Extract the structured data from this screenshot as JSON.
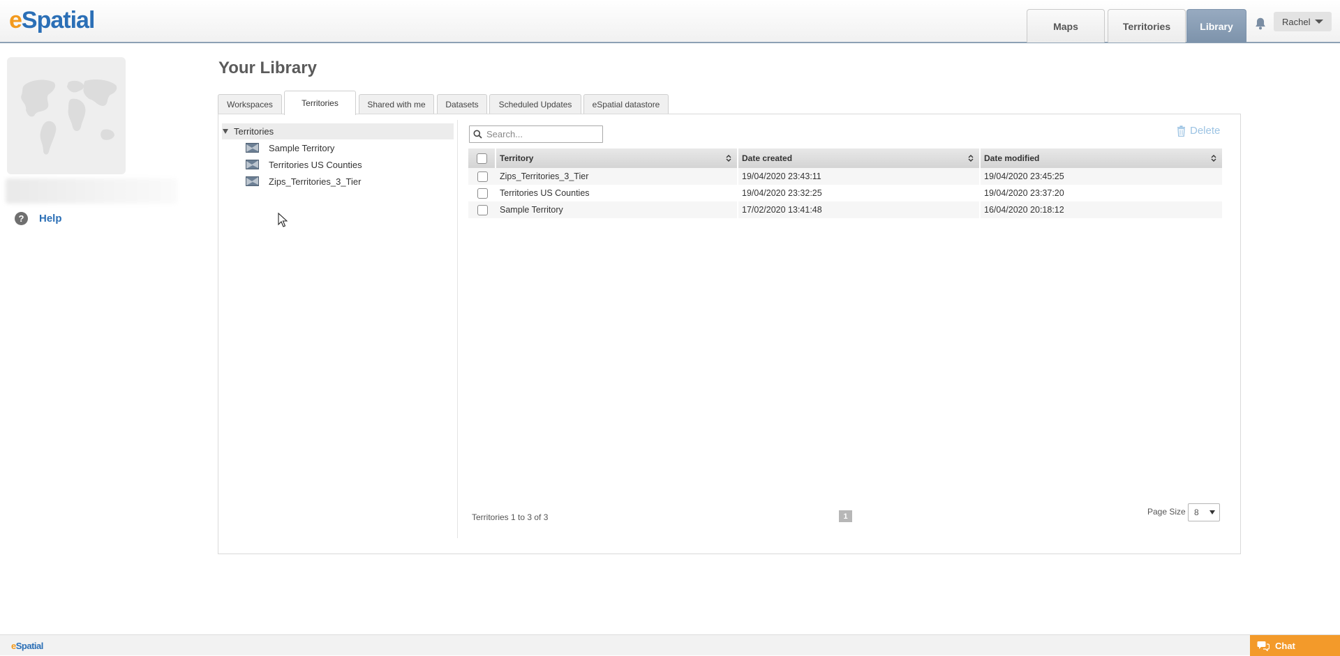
{
  "brand": {
    "logo_e": "e",
    "logo_rest": "Spatial"
  },
  "nav": {
    "maps": "Maps",
    "territories": "Territories",
    "library": "Library"
  },
  "user": {
    "name": "Rachel"
  },
  "sidebar": {
    "help": "Help"
  },
  "page": {
    "title": "Your Library"
  },
  "tabs": [
    "Workspaces",
    "Territories",
    "Shared with me",
    "Datasets",
    "Scheduled Updates",
    "eSpatial datastore"
  ],
  "tree": {
    "root": "Territories",
    "items": [
      "Sample Territory",
      "Territories US Counties",
      "Zips_Territories_3_Tier"
    ]
  },
  "search": {
    "placeholder": "Search..."
  },
  "toolbar": {
    "delete_label": "Delete"
  },
  "grid": {
    "columns": [
      "Territory",
      "Date created",
      "Date modified"
    ],
    "rows": [
      {
        "name": "Zips_Territories_3_Tier",
        "created": "19/04/2020 23:43:11",
        "modified": "19/04/2020 23:45:25"
      },
      {
        "name": "Territories US Counties",
        "created": "19/04/2020 23:32:25",
        "modified": "19/04/2020 23:37:20"
      },
      {
        "name": "Sample Territory",
        "created": "17/02/2020 13:41:48",
        "modified": "16/04/2020 20:18:12"
      }
    ],
    "footer": "Territories 1 to 3 of 3",
    "current_page": "1",
    "page_size_label": "Page Size",
    "page_size": "8"
  },
  "footer": {
    "logo_e": "e",
    "logo_rest": "Spatial",
    "chat": "Chat"
  },
  "colors": {
    "brand_orange": "#f39a1e",
    "brand_blue": "#2b6fb6",
    "active_tab": "#8aa0b8",
    "chat": "#f39a2a"
  }
}
